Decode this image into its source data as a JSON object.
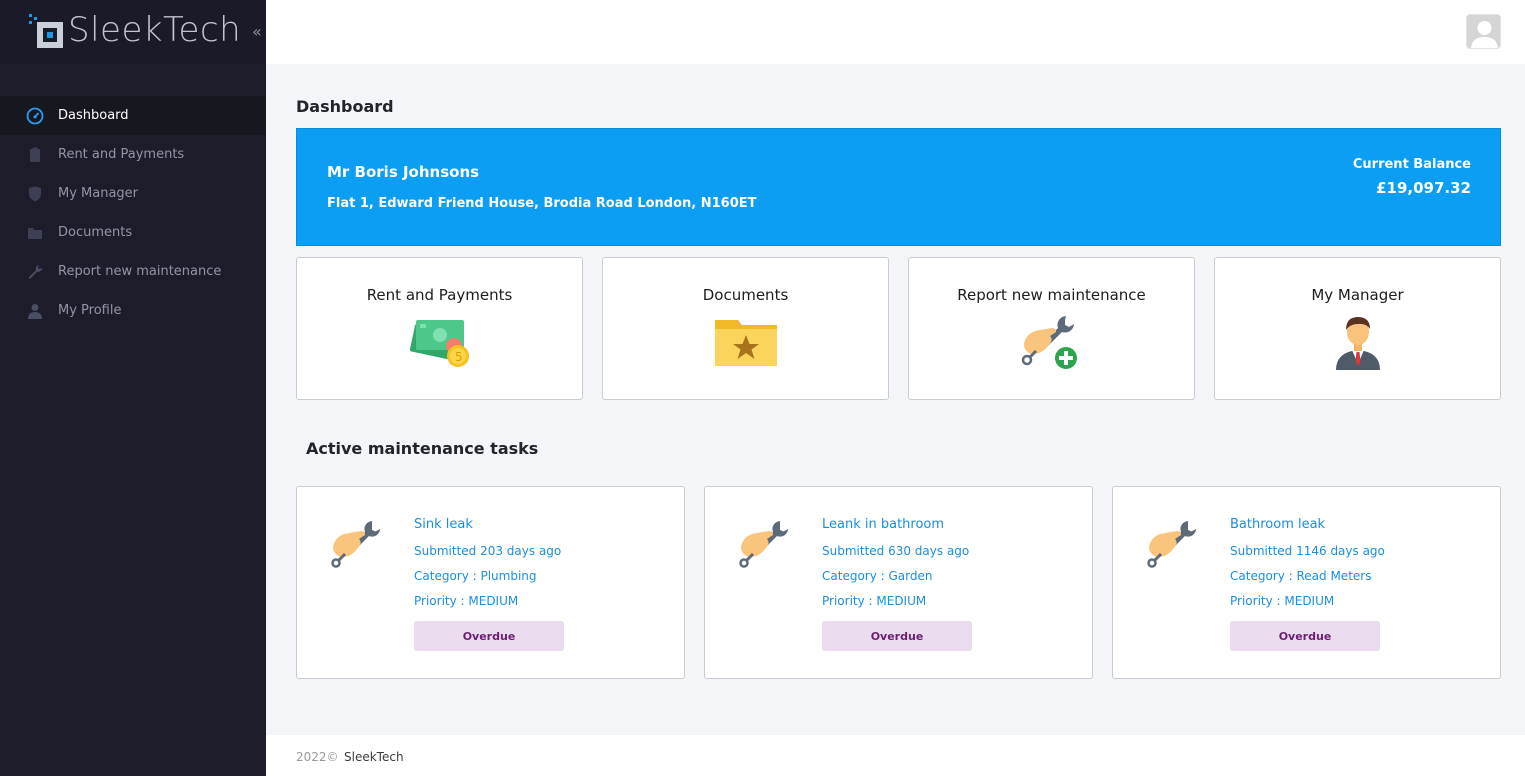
{
  "brand": {
    "name": "SleekTech",
    "collapse_icon": "chevron-double-left-icon"
  },
  "sidebar": {
    "items": [
      {
        "label": "Dashboard",
        "icon": "speedometer-icon",
        "active": true
      },
      {
        "label": "Rent and Payments",
        "icon": "clipboard-icon",
        "active": false
      },
      {
        "label": "My Manager",
        "icon": "shield-icon",
        "active": false
      },
      {
        "label": "Documents",
        "icon": "folder-icon",
        "active": false
      },
      {
        "label": "Report new maintenance",
        "icon": "wrench-icon",
        "active": false
      },
      {
        "label": "My Profile",
        "icon": "user-icon",
        "active": false
      }
    ]
  },
  "header": {
    "avatar": "user-avatar"
  },
  "main": {
    "title": "Dashboard",
    "tenant": {
      "name": "Mr Boris Johnsons",
      "address": "Flat 1, Edward Friend House, Brodia Road London, N160ET",
      "balance_label": "Current Balance",
      "balance_value": "£19,097.32"
    },
    "quick_links": [
      {
        "label": "Rent and Payments",
        "icon": "money-icon"
      },
      {
        "label": "Documents",
        "icon": "star-folder-icon"
      },
      {
        "label": "Report new maintenance",
        "icon": "maintenance-add-icon"
      },
      {
        "label": "My Manager",
        "icon": "manager-icon"
      }
    ],
    "tasks_title": "Active maintenance tasks",
    "tasks": [
      {
        "title": "Sink leak",
        "submitted": "Submitted 203 days ago",
        "category": "Category : Plumbing",
        "priority": "Priority : MEDIUM",
        "status": "Overdue"
      },
      {
        "title": "Leank in bathroom",
        "submitted": "Submitted 630 days ago",
        "category": "Category : Garden",
        "priority": "Priority : MEDIUM",
        "status": "Overdue"
      },
      {
        "title": "Bathroom leak",
        "submitted": "Submitted 1146 days ago",
        "category": "Category : Read Meters",
        "priority": "Priority : MEDIUM",
        "status": "Overdue"
      }
    ]
  },
  "footer": {
    "year": "2022©",
    "company": "SleekTech"
  },
  "colors": {
    "sidebar": "#1c1c2b",
    "accent": "#0c9ef2",
    "link": "#1a8fe0",
    "badge_bg": "#ecdcef",
    "badge_text": "#6b1f70"
  }
}
